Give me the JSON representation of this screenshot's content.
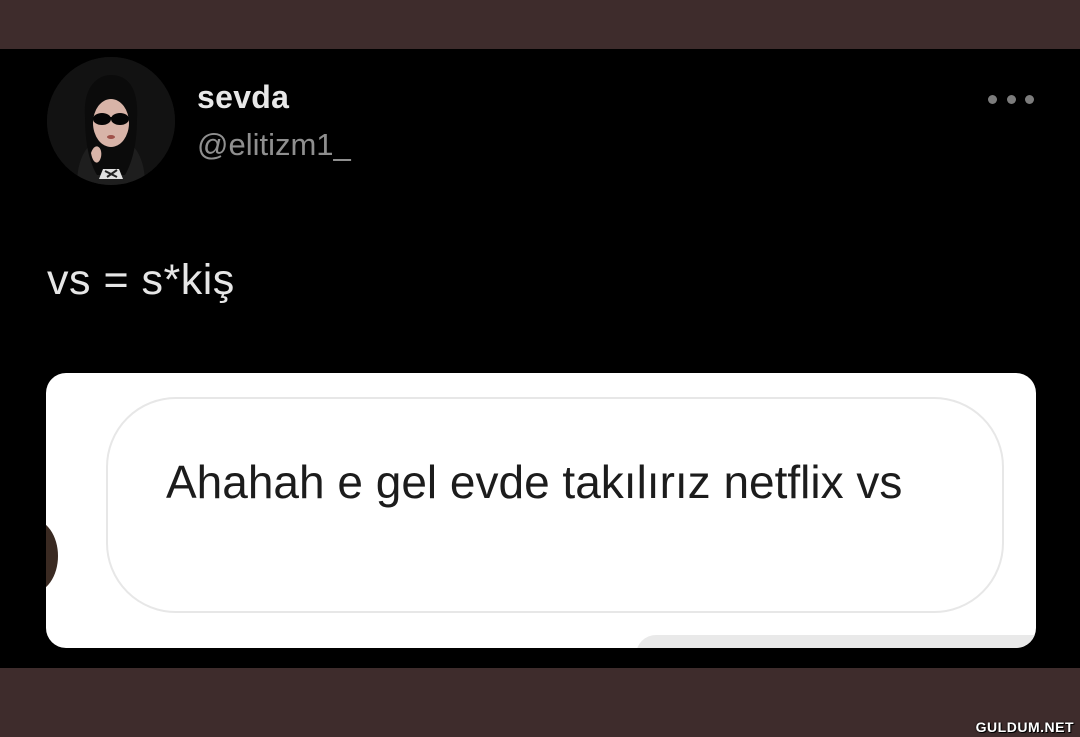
{
  "tweet": {
    "author": {
      "display_name": "sevda",
      "handle": "@elitizm1_",
      "avatar_icon": "profile-photo"
    },
    "more_icon": "more-horizontal-icon",
    "text": "vs = s*kiş"
  },
  "embedded_message": {
    "text": "Ahahah e gel evde takılırız netflix vs"
  },
  "watermark": "GULDUM.NET"
}
